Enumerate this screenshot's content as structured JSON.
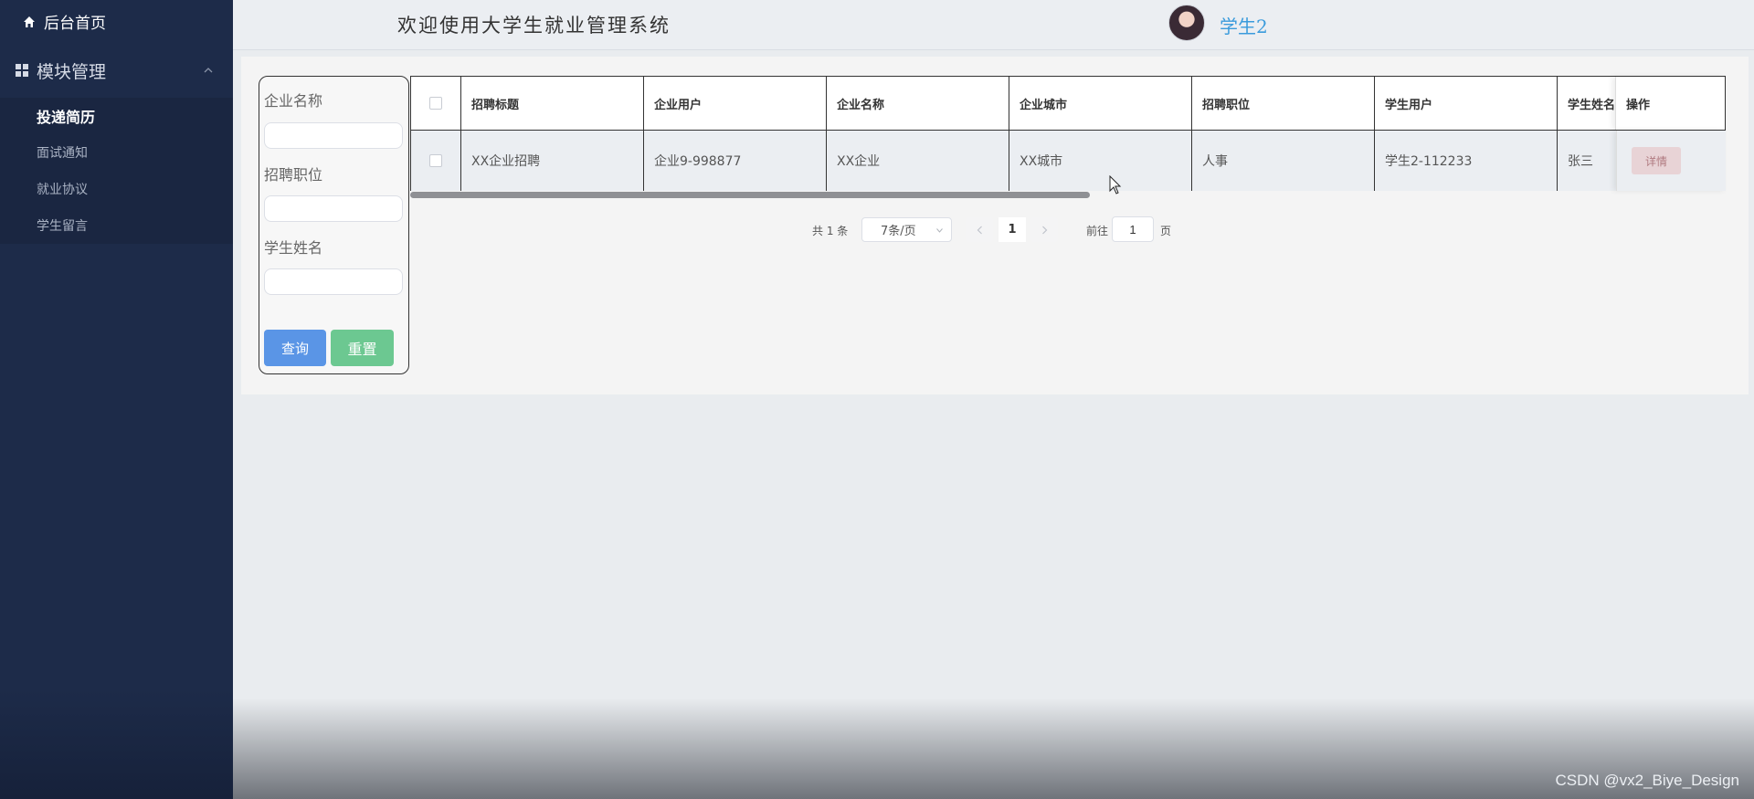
{
  "sidebar": {
    "home_label": "后台首页",
    "module_label": "模块管理",
    "items": [
      {
        "label": "投递简历",
        "active": true
      },
      {
        "label": "面试通知",
        "active": false
      },
      {
        "label": "就业协议",
        "active": false
      },
      {
        "label": "学生留言",
        "active": false
      }
    ]
  },
  "header": {
    "title": "欢迎使用大学生就业管理系统",
    "username": "学生2"
  },
  "search": {
    "company_name_label": "企业名称",
    "position_label": "招聘职位",
    "student_name_label": "学生姓名",
    "company_name_value": "",
    "position_value": "",
    "student_name_value": "",
    "query_label": "查询",
    "reset_label": "重置"
  },
  "table": {
    "columns": [
      "招聘标题",
      "企业用户",
      "企业名称",
      "企业城市",
      "招聘职位",
      "学生用户",
      "学生姓名",
      "操作"
    ],
    "rows": [
      {
        "title": "XX企业招聘",
        "company_user": "企业9-998877",
        "company_name": "XX企业",
        "city": "XX城市",
        "position": "人事",
        "student_user": "学生2-112233",
        "student_name": "张三",
        "action": "详情"
      }
    ]
  },
  "pager": {
    "total_text": "共 1 条",
    "page_size": "7条/页",
    "current_page": "1",
    "goto_label": "前往",
    "goto_value": "1",
    "page_suffix": "页"
  },
  "watermark": "CSDN @vx2_Biye_Design",
  "colors": {
    "sidebar_bg": "#1d2b49",
    "query_btn": "#5a95e6",
    "reset_btn": "#6cc891",
    "username": "#3a9bdc"
  },
  "icons": {
    "home": "home-icon",
    "module": "grid-icon",
    "chevron": "chevron-up-icon"
  }
}
